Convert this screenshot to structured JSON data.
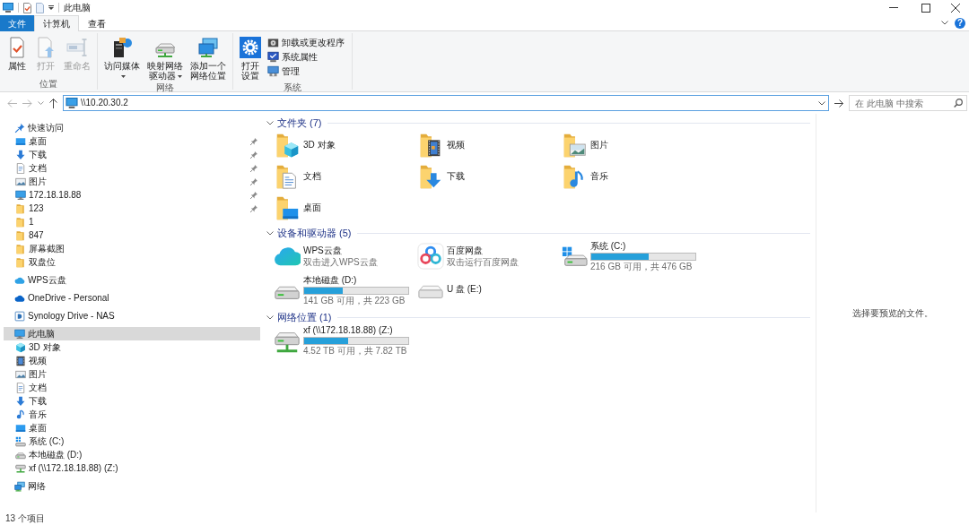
{
  "window": {
    "title": "此电脑"
  },
  "tabs": [
    {
      "label": "文件",
      "kind": "file",
      "selected": false
    },
    {
      "label": "计算机",
      "kind": "tab",
      "selected": true
    },
    {
      "label": "查看",
      "kind": "tab",
      "selected": false
    }
  ],
  "ribbon_help": {
    "label": "?"
  },
  "ribbon": {
    "groups": [
      {
        "label": "位置",
        "large": [
          {
            "lines": [
              "属性"
            ],
            "kind": "properties",
            "disabled": false,
            "dropdown": false
          },
          {
            "lines": [
              "打开"
            ],
            "kind": "open",
            "disabled": true,
            "dropdown": false
          },
          {
            "lines": [
              "重命名"
            ],
            "kind": "rename",
            "disabled": true,
            "dropdown": false
          }
        ]
      },
      {
        "label": "网络",
        "large": [
          {
            "lines": [
              "访问媒体"
            ],
            "kind": "media",
            "disabled": false,
            "dropdown": true
          },
          {
            "lines": [
              "映射网络",
              "驱动器"
            ],
            "kind": "mapdrive",
            "disabled": false,
            "dropdown": true
          },
          {
            "lines": [
              "添加一个",
              "网络位置"
            ],
            "kind": "addlocation",
            "disabled": false,
            "dropdown": false
          }
        ]
      },
      {
        "label": "系统",
        "large": [
          {
            "lines": [
              "打开",
              "设置"
            ],
            "kind": "settings",
            "disabled": false,
            "dropdown": false
          }
        ],
        "small": [
          {
            "label": "卸载或更改程序",
            "kind": "uninstall"
          },
          {
            "label": "系统属性",
            "kind": "sysprops"
          },
          {
            "label": "管理",
            "kind": "manage"
          }
        ]
      }
    ]
  },
  "address_bar": {
    "value": "\\\\10.20.30.2"
  },
  "search": {
    "placeholder": "在 此电脑 中搜索"
  },
  "sidebar": {
    "items": [
      {
        "label": "快速访问",
        "kind": "quick",
        "selected": false,
        "children": [
          {
            "label": "桌面",
            "kind": "desktop",
            "pinned": true,
            "selected": false
          },
          {
            "label": "下载",
            "kind": "download",
            "pinned": true,
            "selected": false
          },
          {
            "label": "文档",
            "kind": "document",
            "pinned": true,
            "selected": false
          },
          {
            "label": "图片",
            "kind": "picture",
            "pinned": true,
            "selected": false
          },
          {
            "label": "172.18.18.88",
            "kind": "monitor",
            "pinned": true,
            "selected": false
          },
          {
            "label": "123",
            "kind": "folder",
            "pinned": true,
            "selected": false
          },
          {
            "label": "1",
            "kind": "folder",
            "pinned": false,
            "selected": false
          },
          {
            "label": "847",
            "kind": "folder",
            "pinned": false,
            "selected": false
          },
          {
            "label": "屏幕截图",
            "kind": "folder",
            "pinned": false,
            "selected": false
          },
          {
            "label": "双盘位",
            "kind": "folder",
            "pinned": false,
            "selected": false
          }
        ]
      },
      {
        "label": "WPS云盘",
        "kind": "cloud",
        "selected": false
      },
      {
        "label": "OneDrive - Personal",
        "kind": "onedrive",
        "selected": false
      },
      {
        "label": "Synology Drive - NAS",
        "kind": "synology",
        "selected": false
      },
      {
        "label": "此电脑",
        "kind": "pc",
        "selected": true,
        "children": [
          {
            "label": "3D 对象",
            "kind": "cube",
            "selected": false
          },
          {
            "label": "视频",
            "kind": "video",
            "selected": false
          },
          {
            "label": "图片",
            "kind": "picture",
            "selected": false
          },
          {
            "label": "文档",
            "kind": "document",
            "selected": false
          },
          {
            "label": "下载",
            "kind": "download",
            "selected": false
          },
          {
            "label": "音乐",
            "kind": "music",
            "selected": false
          },
          {
            "label": "桌面",
            "kind": "desktop",
            "selected": false
          },
          {
            "label": "系统 (C:)",
            "kind": "sysdrive",
            "selected": false
          },
          {
            "label": "本地磁盘 (D:)",
            "kind": "drive",
            "selected": false
          },
          {
            "label": "xf (\\\\172.18.18.88) (Z:)",
            "kind": "netdrive",
            "selected": false
          }
        ]
      },
      {
        "label": "网络",
        "kind": "network",
        "selected": false
      }
    ]
  },
  "content": {
    "sections": [
      {
        "title": "文件夹 (7)",
        "expanded": true,
        "items": [
          {
            "name": "3D 对象",
            "kind": "cube"
          },
          {
            "name": "视频",
            "kind": "video"
          },
          {
            "name": "图片",
            "kind": "picture"
          },
          {
            "name": "文档",
            "kind": "document"
          },
          {
            "name": "下载",
            "kind": "download"
          },
          {
            "name": "音乐",
            "kind": "music"
          },
          {
            "name": "桌面",
            "kind": "desktop"
          }
        ]
      },
      {
        "title": "设备和驱动器 (5)",
        "expanded": true,
        "items": [
          {
            "name": "WPS云盘",
            "kind": "cloud",
            "subtitle": "双击进入WPS云盘"
          },
          {
            "name": "百度网盘",
            "kind": "rings",
            "subtitle": "双击运行百度网盘"
          },
          {
            "name": "系统 (C:)",
            "kind": "sysdrive",
            "level": 0.55,
            "usage": "216 GB 可用，共 476 GB"
          },
          {
            "name": "本地磁盘 (D:)",
            "kind": "drive",
            "level": 0.37,
            "usage": "141 GB 可用，共 223 GB"
          },
          {
            "name": "U 盘 (E:)",
            "kind": "removable"
          }
        ]
      },
      {
        "title": "网络位置 (1)",
        "expanded": true,
        "items": [
          {
            "name": "xf (\\\\172.18.18.88) (Z:)",
            "kind": "netdrive",
            "level": 0.42,
            "usage": "4.52 TB 可用，共 7.82 TB"
          }
        ]
      }
    ]
  },
  "preview": {
    "message": "选择要预览的文件。"
  },
  "status_bar": {
    "item_count": "13 个项目"
  }
}
